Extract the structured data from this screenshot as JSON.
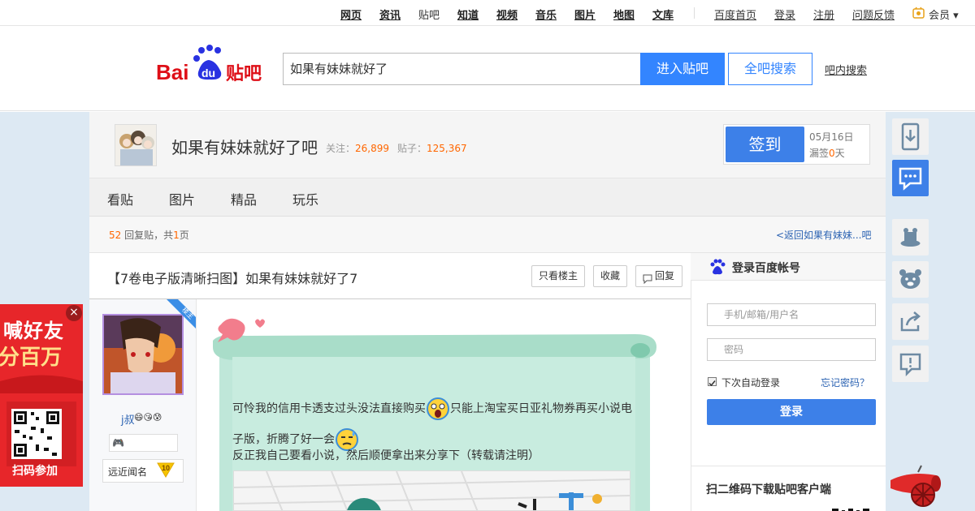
{
  "topnav": {
    "items": [
      "网页",
      "资讯",
      "贴吧",
      "知道",
      "视频",
      "音乐",
      "图片",
      "地图",
      "文库"
    ],
    "right": [
      "百度首页",
      "登录",
      "注册",
      "问题反馈"
    ],
    "member": "会员"
  },
  "header": {
    "logo_text_bai": "Bai",
    "logo_text_du": "du",
    "logo_text_tieba": "贴吧",
    "search_value": "如果有妹妹就好了",
    "enter_button": "进入贴吧",
    "all_search_button": "全吧搜索",
    "in_bar_search": "吧内搜索"
  },
  "forum": {
    "name": "如果有妹妹就好了吧",
    "follow_label": "关注：",
    "follow_count": "26,899",
    "posts_label": "贴子：",
    "posts_count": "125,367",
    "sign_button": "签到",
    "sign_date": "05月16日",
    "sign_missed_prefix": "漏签",
    "sign_missed_count": "0",
    "sign_missed_suffix": "天"
  },
  "tabs": [
    "看贴",
    "图片",
    "精品",
    "玩乐"
  ],
  "reply_bar": {
    "count": "52",
    "count_label": "回复贴，共",
    "pages": "1",
    "pages_label": "页",
    "back_link": "<返回如果有妹妹...吧"
  },
  "thread": {
    "title": "【7卷电子版清晰扫图】如果有妹妹就好了7",
    "only_op": "只看楼主",
    "favorite": "收藏",
    "reply": "回复"
  },
  "author": {
    "ribbon": "楼主",
    "name": "j叔",
    "level_label": "远近闻名",
    "level": "10"
  },
  "post": {
    "line1a": "可怜我的信用卡透支过头没法直接购买",
    "line1b": "只能上淘宝买日亚礼物券再买小说电",
    "line2": "子版，折腾了好一会",
    "line3": "反正我自己要看小说，然后顺便拿出来分享下（转载请注明）"
  },
  "login": {
    "title": "登录百度帐号",
    "username_placeholder": "手机/邮箱/用户名",
    "password_placeholder": "密码",
    "remember": "下次自动登录",
    "forgot": "忘记密码？",
    "button": "登录",
    "qr_title": "扫二维码下载贴吧客户端"
  },
  "ad": {
    "line1": "喊好友",
    "line2": "分百万",
    "scan": "扫码参加",
    "close": "×"
  },
  "colors": {
    "brand_blue": "#3385ff",
    "accent_orange": "#ff6600",
    "logo_red": "#de0f17",
    "paper_teal": "#bfe7d9"
  }
}
